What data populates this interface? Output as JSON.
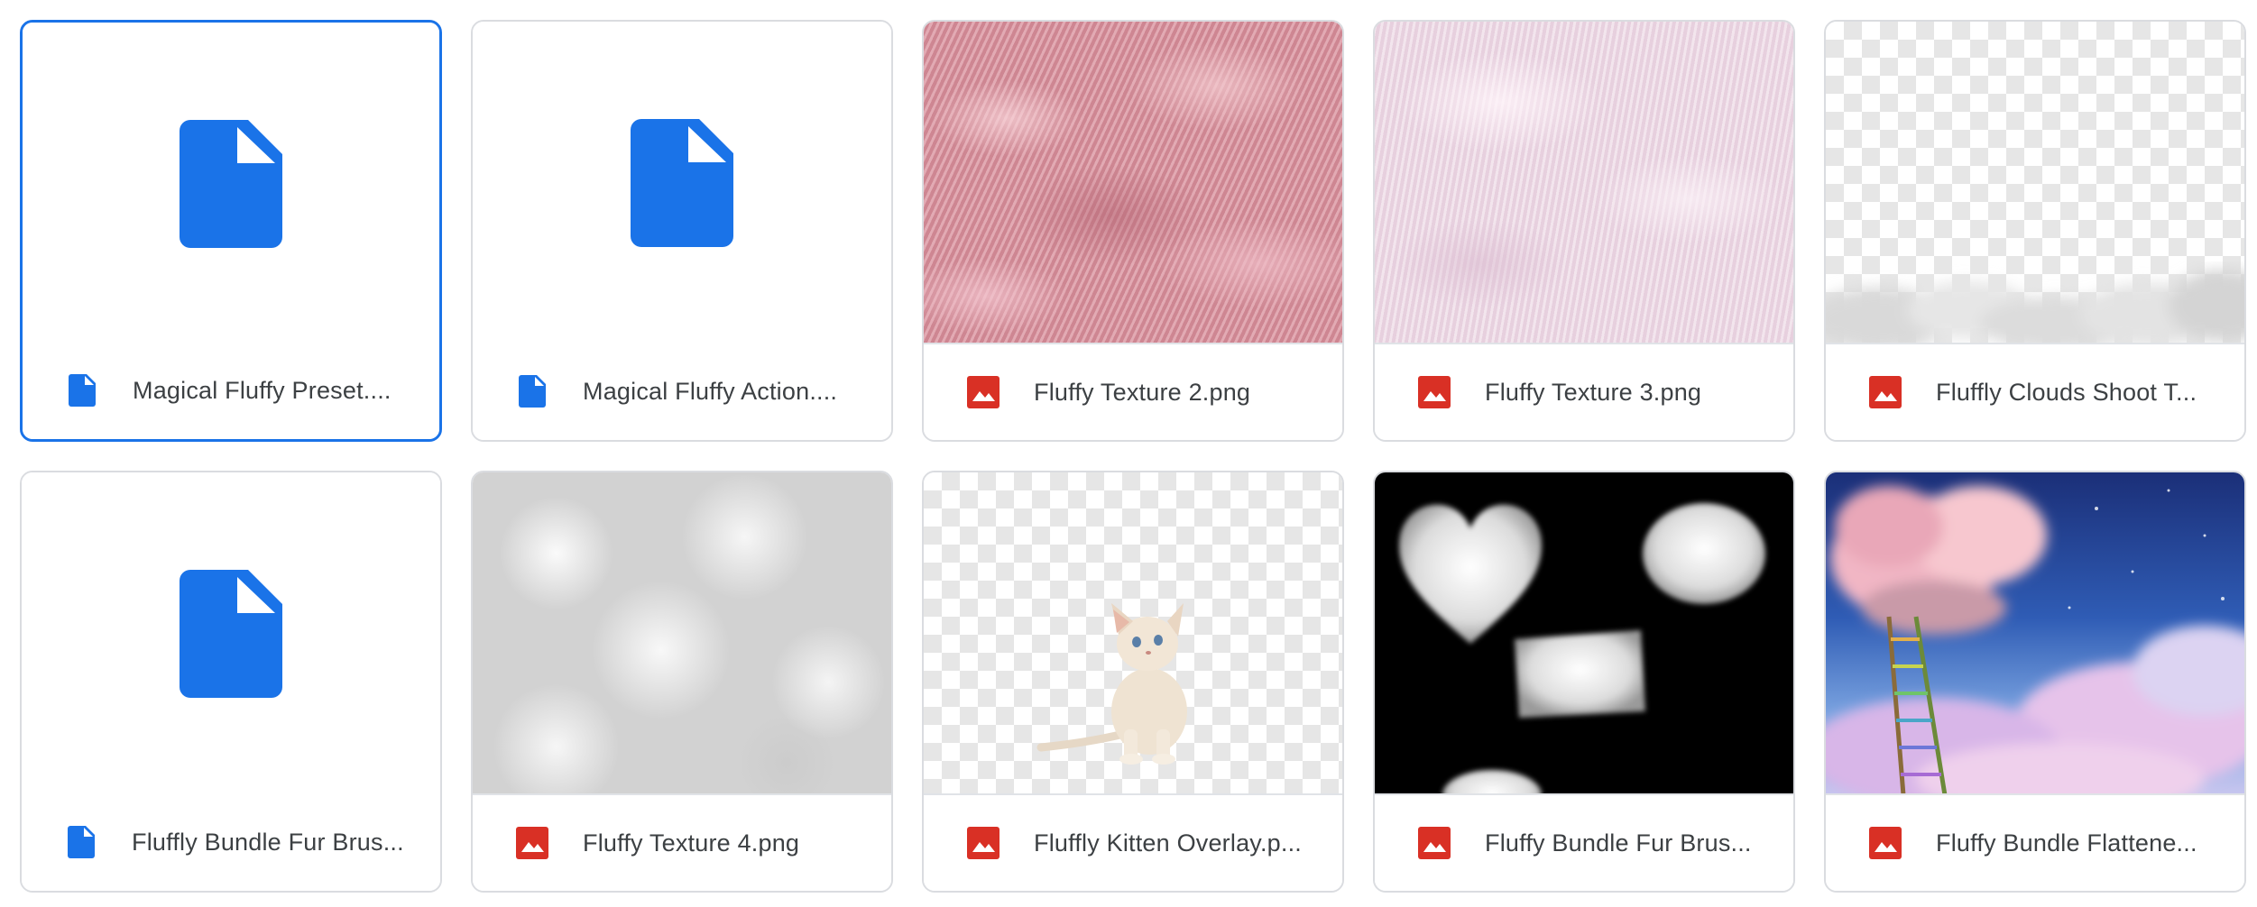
{
  "files": [
    {
      "name": "Magical Fluffy Preset....",
      "type": "document",
      "icon": "document-icon",
      "selected": true
    },
    {
      "name": "Magical Fluffy Action....",
      "type": "document",
      "icon": "document-icon",
      "selected": false
    },
    {
      "name": "Fluffy Texture 2.png",
      "type": "image",
      "icon": "image-icon",
      "thumbnail": "pink-fur-texture"
    },
    {
      "name": "Fluffy Texture 3.png",
      "type": "image",
      "icon": "image-icon",
      "thumbnail": "light-pink-fur-texture"
    },
    {
      "name": "Fluffly Clouds Shoot T...",
      "type": "image",
      "icon": "image-icon",
      "thumbnail": "transparent-clouds-overlay"
    },
    {
      "name": "Fluffly Bundle Fur Brus...",
      "type": "document",
      "icon": "document-icon",
      "selected": false
    },
    {
      "name": "Fluffy Texture 4.png",
      "type": "image",
      "icon": "image-icon",
      "thumbnail": "white-cotton-texture"
    },
    {
      "name": "Fluffly Kitten Overlay.p...",
      "type": "image",
      "icon": "image-icon",
      "thumbnail": "kitten-on-transparent"
    },
    {
      "name": "Fluffy Bundle Fur Brus...",
      "type": "image",
      "icon": "image-icon",
      "thumbnail": "fur-brush-shapes-on-black"
    },
    {
      "name": "Fluffy Bundle Flattene...",
      "type": "image",
      "icon": "image-icon",
      "thumbnail": "pink-cloud-ladder-sky"
    }
  ],
  "colors": {
    "doc_blue": "#1a73e8",
    "image_red": "#d93025",
    "selected_border": "#1a73e8"
  }
}
